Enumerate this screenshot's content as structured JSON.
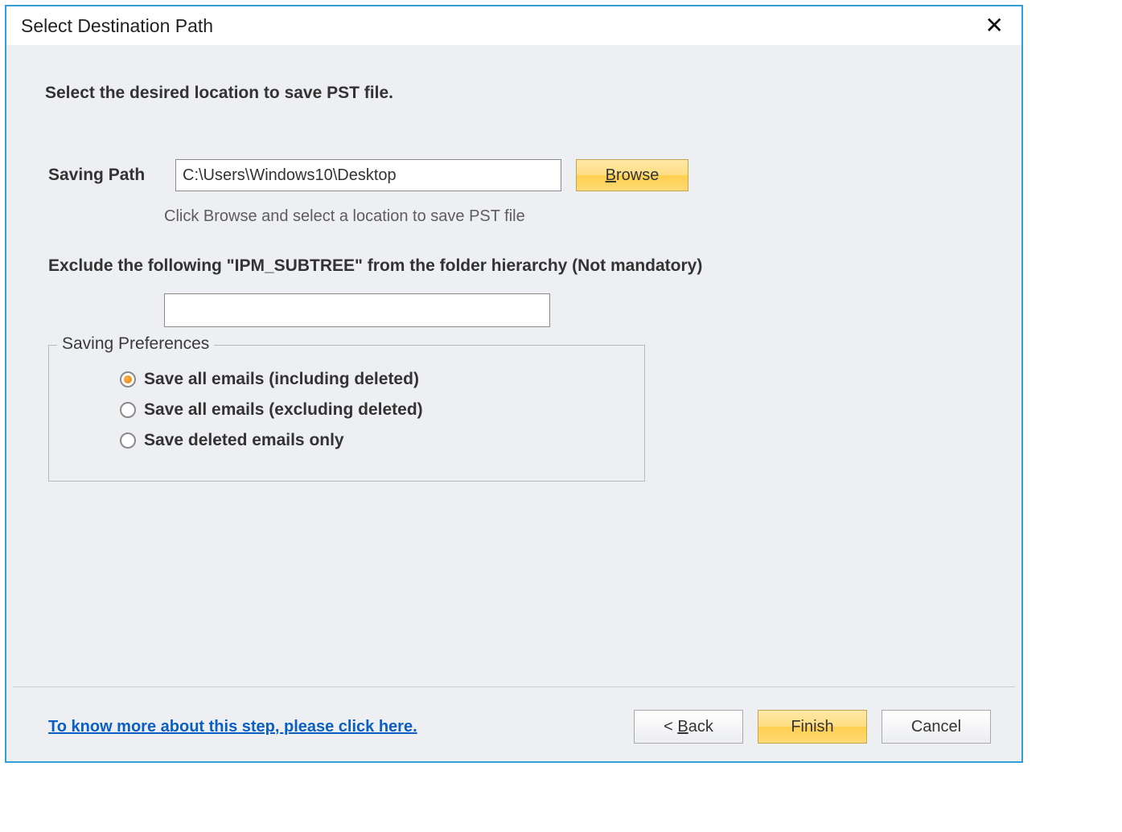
{
  "dialog": {
    "title": "Select Destination Path",
    "instruction": "Select the desired location to save PST file.",
    "saving_path_label": "Saving Path",
    "saving_path_value": "C:\\Users\\Windows10\\Desktop",
    "browse_label": "Browse",
    "hint": "Click Browse and select a location to save PST file",
    "exclude_label": "Exclude the following \"IPM_SUBTREE\" from the folder hierarchy (Not mandatory)",
    "exclude_value": "",
    "preferences": {
      "legend": "Saving Preferences",
      "options": [
        {
          "label": "Save all emails (including deleted)",
          "selected": true
        },
        {
          "label": "Save all emails (excluding deleted)",
          "selected": false
        },
        {
          "label": "Save deleted emails only",
          "selected": false
        }
      ]
    },
    "help_link": "To know more about this step, please click here.",
    "buttons": {
      "back": "< Back",
      "finish": "Finish",
      "cancel": "Cancel"
    }
  }
}
